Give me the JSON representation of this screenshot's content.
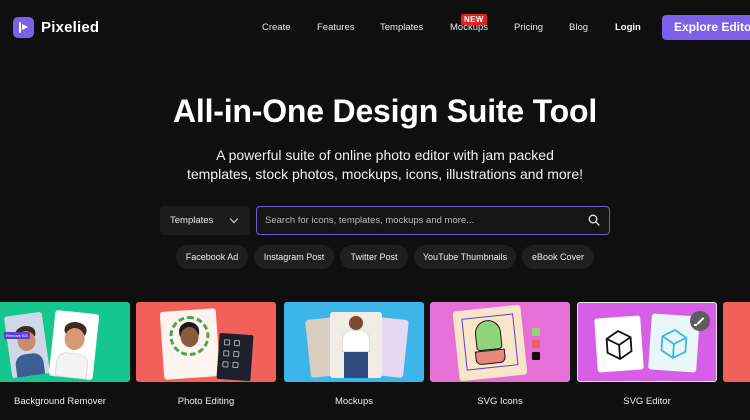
{
  "brand": {
    "name": "Pixelied",
    "color": "#7b61e8"
  },
  "nav": {
    "links": [
      "Create",
      "Features",
      "Templates",
      "Mockups",
      "Pricing",
      "Blog"
    ],
    "badge": "NEW",
    "login": "Login",
    "cta": "Explore Editor"
  },
  "hero": {
    "title": "All-in-One Design Suite Tool",
    "subtitle_line1": "A powerful suite of online photo editor with jam packed",
    "subtitle_line2": "templates, stock photos, mockups, icons, illustrations and more!"
  },
  "search": {
    "category": "Templates",
    "placeholder": "Search for icons, templates, mockups and more..."
  },
  "chips": [
    "Facebook Ad",
    "Instagram Post",
    "Twitter Post",
    "YouTube Thumbnails",
    "eBook Cover"
  ],
  "cards": [
    {
      "label": "Background Remover",
      "color": "#15c78e",
      "tag": "Remove BG"
    },
    {
      "label": "Photo Editing",
      "color": "#f2605a"
    },
    {
      "label": "Mockups",
      "color": "#3cb6e8"
    },
    {
      "label": "SVG Icons",
      "color": "#e66fd8"
    },
    {
      "label": "SVG Editor",
      "color": "#d75ee6"
    }
  ]
}
